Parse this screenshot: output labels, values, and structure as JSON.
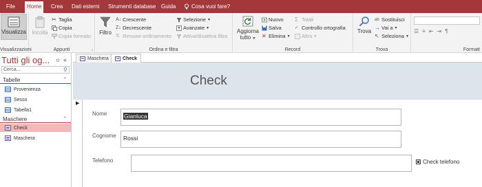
{
  "menu": {
    "tabs": [
      "File",
      "Home",
      "Crea",
      "Dati esterni",
      "Strumenti database",
      "Guida"
    ],
    "search_label": "Cosa vuoi fare?"
  },
  "ribbon": {
    "views": {
      "visualizza": "Visualizza",
      "group_label": "Visualizzazioni"
    },
    "clipboard": {
      "incolla": "Incolla",
      "taglia": "Taglia",
      "copia": "Copia",
      "copia_formato": "Copia formato",
      "group_label": "Appunti"
    },
    "sort_filter": {
      "filtro": "Filtro",
      "crescente": "Crescente",
      "decrescente": "Decrescente",
      "rimuovi": "Rimuovi ordinamento",
      "selezione": "Selezione",
      "avanzate": "Avanzate",
      "attiva": "Attiva/disattiva filtro",
      "group_label": "Ordina e filtra"
    },
    "records": {
      "aggiorna": "Aggiorna",
      "tutto": "tutto",
      "nuovo": "Nuovo",
      "salva": "Salva",
      "elimina": "Elimina",
      "totali": "Totali",
      "controllo": "Controllo ortografia",
      "altro": "Altro",
      "group_label": "Record"
    },
    "find": {
      "trova": "Trova",
      "sostituisci": "Sostituisci",
      "vai_a": "Vai a",
      "seleziona": "Seleziona",
      "group_label": "Trova"
    },
    "format": {
      "group_label": "Formatt"
    }
  },
  "nav": {
    "title": "Tutti gli og...",
    "search_placeholder": "Cerca...",
    "sections": [
      {
        "label": "Tabelle",
        "items": [
          "Provenienza",
          "Sesso",
          "Tabella1"
        ]
      },
      {
        "label": "Maschere",
        "items": [
          "Check",
          "Maschera"
        ]
      }
    ]
  },
  "doc_tabs": [
    "Maschera",
    "Check"
  ],
  "form": {
    "title": "Check",
    "fields": [
      {
        "label": "Nome",
        "value": "Gianluca"
      },
      {
        "label": "Cognome",
        "value": "Rossi"
      },
      {
        "label": "Telefono",
        "value": ""
      }
    ],
    "checkbox_label": "Check telefono"
  },
  "colors": {
    "accent": "#a4373a",
    "header_bg": "#dee4ec",
    "selected_nav": "#f4b8b8"
  }
}
